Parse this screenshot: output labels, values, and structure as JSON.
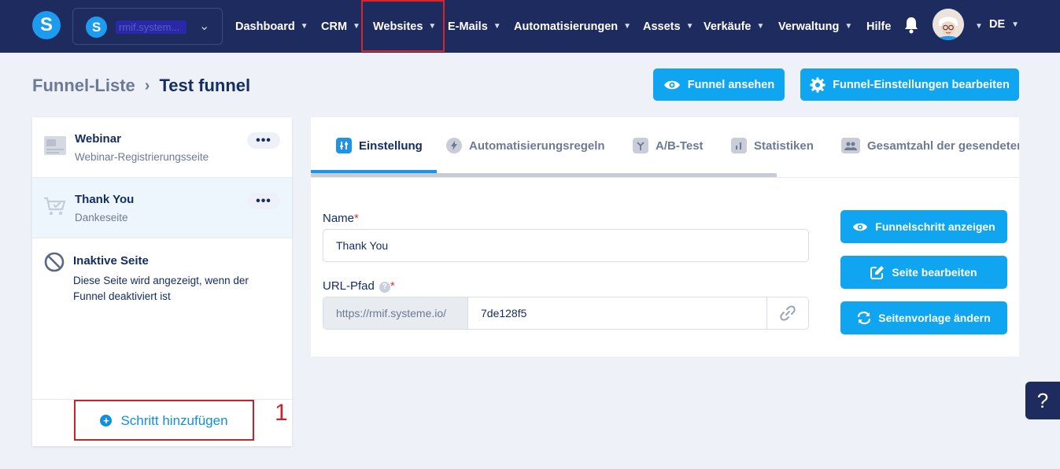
{
  "workspace": {
    "name": "rmif.system..."
  },
  "nav": {
    "items": [
      {
        "label": "Dashboard"
      },
      {
        "label": "CRM"
      },
      {
        "label": "Websites"
      },
      {
        "label": "E-Mails"
      },
      {
        "label": "Automatisierungen"
      },
      {
        "label": "Assets"
      },
      {
        "label": "Verkäufe"
      },
      {
        "label": "Verwaltung"
      },
      {
        "label": "Hilfe"
      }
    ],
    "language": "DE"
  },
  "breadcrumb": {
    "parent": "Funnel-Liste",
    "current": "Test funnel"
  },
  "header_buttons": {
    "view_funnel": "Funnel ansehen",
    "edit_settings": "Funnel-Einstellungen bearbeiten"
  },
  "steps": [
    {
      "title": "Webinar",
      "subtitle": "Webinar-Registrierungsseite",
      "menu": "•••"
    },
    {
      "title": "Thank You",
      "subtitle": "Dankeseite",
      "menu": "•••"
    }
  ],
  "inactive_page": {
    "title": "Inaktive Seite",
    "description": "Diese Seite wird angezeigt, wenn der Funnel deaktiviert ist"
  },
  "add_step": {
    "label": "Schritt hinzufügen"
  },
  "annotation": {
    "marker": "1"
  },
  "tabs": [
    {
      "label": "Einstellung"
    },
    {
      "label": "Automatisierungsregeln"
    },
    {
      "label": "A/B-Test"
    },
    {
      "label": "Statistiken"
    },
    {
      "label": "Gesamtzahl der gesendeten"
    }
  ],
  "form": {
    "name_label": "Name",
    "name_value": "Thank You",
    "required_mark": "*",
    "url_label": "URL-Pfad",
    "url_help": "?",
    "url_prefix": "https://rmif.systeme.io/",
    "url_slug": "7de128f5"
  },
  "actions": {
    "show_step": "Funnelschritt anzeigen",
    "edit_page": "Seite bearbeiten",
    "change_template": "Seitenvorlage ändern"
  },
  "help_widget": {
    "label": "?"
  },
  "colors": {
    "nav_bg": "#1e2b5e",
    "primary": "#0fa5f0",
    "highlight": "#d4262b"
  }
}
